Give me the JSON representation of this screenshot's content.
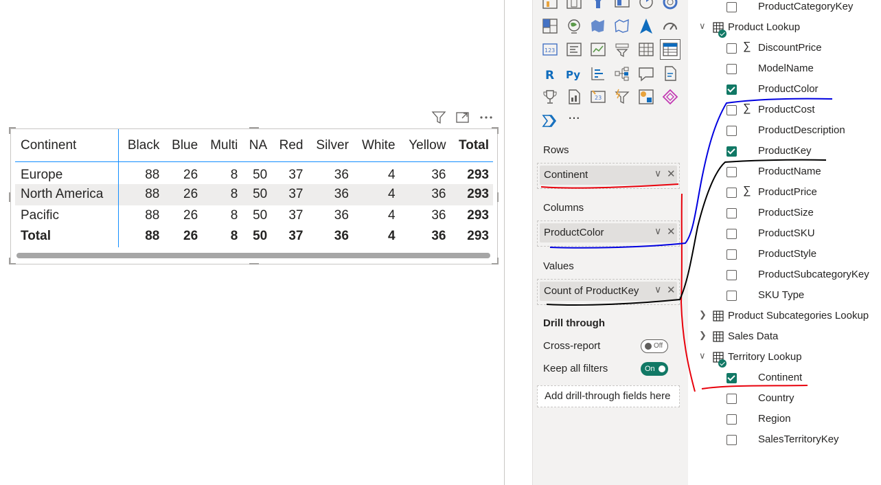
{
  "matrix": {
    "headers": [
      "Continent",
      "Black",
      "Blue",
      "Multi",
      "NA",
      "Red",
      "Silver",
      "White",
      "Yellow",
      "Total"
    ],
    "rows": [
      {
        "label": "Europe",
        "values": [
          "88",
          "26",
          "8",
          "50",
          "37",
          "36",
          "4",
          "36",
          "293"
        ]
      },
      {
        "label": "North America",
        "values": [
          "88",
          "26",
          "8",
          "50",
          "37",
          "36",
          "4",
          "36",
          "293"
        ]
      },
      {
        "label": "Pacific",
        "values": [
          "88",
          "26",
          "8",
          "50",
          "37",
          "36",
          "4",
          "36",
          "293"
        ]
      }
    ],
    "total": {
      "label": "Total",
      "values": [
        "88",
        "26",
        "8",
        "50",
        "37",
        "36",
        "4",
        "36",
        "293"
      ]
    }
  },
  "visual_header_icons": [
    "filter-icon",
    "focus-mode-icon",
    "more-options-icon"
  ],
  "visualizations": {
    "wells": {
      "rows": {
        "label": "Rows",
        "field": "Continent"
      },
      "columns": {
        "label": "Columns",
        "field": "ProductColor"
      },
      "values": {
        "label": "Values",
        "field": "Count of ProductKey"
      }
    },
    "drill_through": {
      "title": "Drill through",
      "cross_report": {
        "label": "Cross-report",
        "state": "Off"
      },
      "keep_all_filters": {
        "label": "Keep all filters",
        "state": "On"
      },
      "add_fields": "Add drill-through fields here"
    },
    "more_glyph": "···",
    "icon_names": [
      "stacked-bar-icon",
      "clustered-bar-icon",
      "funnel-icon",
      "ribbon-icon",
      "pie-icon",
      "donut-icon",
      "treemap-icon",
      "map-icon",
      "filled-map-icon",
      "shape-map-icon",
      "azure-map-icon",
      "gauge-icon",
      "card-icon",
      "multi-row-card-icon",
      "kpi-icon",
      "slicer-icon",
      "table-icon",
      "matrix-icon",
      "r-visual-icon",
      "python-visual-icon",
      "key-influencers-icon",
      "decomposition-tree-icon",
      "qa-icon",
      "smart-narrative-icon",
      "trophy-icon",
      "paginated-report-icon",
      "scorecard-icon",
      "power-apps-icon",
      "power-automate-icon",
      "diamond-icon",
      "chevrons-icon"
    ]
  },
  "fields": {
    "items": [
      {
        "kind": "field",
        "name": "ProductCategoryKey",
        "checked": false,
        "sigma": false
      },
      {
        "kind": "table",
        "name": "Product Lookup",
        "expanded": true,
        "badge": true
      },
      {
        "kind": "field",
        "name": "DiscountPrice",
        "checked": false,
        "sigma": true
      },
      {
        "kind": "field",
        "name": "ModelName",
        "checked": false,
        "sigma": false
      },
      {
        "kind": "field",
        "name": "ProductColor",
        "checked": true,
        "sigma": false
      },
      {
        "kind": "field",
        "name": "ProductCost",
        "checked": false,
        "sigma": true
      },
      {
        "kind": "field",
        "name": "ProductDescription",
        "checked": false,
        "sigma": false
      },
      {
        "kind": "field",
        "name": "ProductKey",
        "checked": true,
        "sigma": false
      },
      {
        "kind": "field",
        "name": "ProductName",
        "checked": false,
        "sigma": false
      },
      {
        "kind": "field",
        "name": "ProductPrice",
        "checked": false,
        "sigma": true
      },
      {
        "kind": "field",
        "name": "ProductSize",
        "checked": false,
        "sigma": false
      },
      {
        "kind": "field",
        "name": "ProductSKU",
        "checked": false,
        "sigma": false
      },
      {
        "kind": "field",
        "name": "ProductStyle",
        "checked": false,
        "sigma": false
      },
      {
        "kind": "field",
        "name": "ProductSubcategoryKey",
        "checked": false,
        "sigma": false
      },
      {
        "kind": "field",
        "name": "SKU Type",
        "checked": false,
        "sigma": false
      },
      {
        "kind": "table",
        "name": "Product Subcategories Lookup",
        "expanded": false,
        "badge": false
      },
      {
        "kind": "table",
        "name": "Sales Data",
        "expanded": false,
        "badge": false
      },
      {
        "kind": "table",
        "name": "Territory Lookup",
        "expanded": true,
        "badge": true
      },
      {
        "kind": "field",
        "name": "Continent",
        "checked": true,
        "sigma": false
      },
      {
        "kind": "field",
        "name": "Country",
        "checked": false,
        "sigma": false
      },
      {
        "kind": "field",
        "name": "Region",
        "checked": false,
        "sigma": false
      },
      {
        "kind": "field",
        "name": "SalesTerritoryKey",
        "checked": false,
        "sigma": false
      }
    ]
  },
  "colors": {
    "accent": "#118dff",
    "check_green": "#117865",
    "annotation_red": "#e8000b",
    "annotation_blue": "#0000e0",
    "annotation_black": "#000000"
  }
}
